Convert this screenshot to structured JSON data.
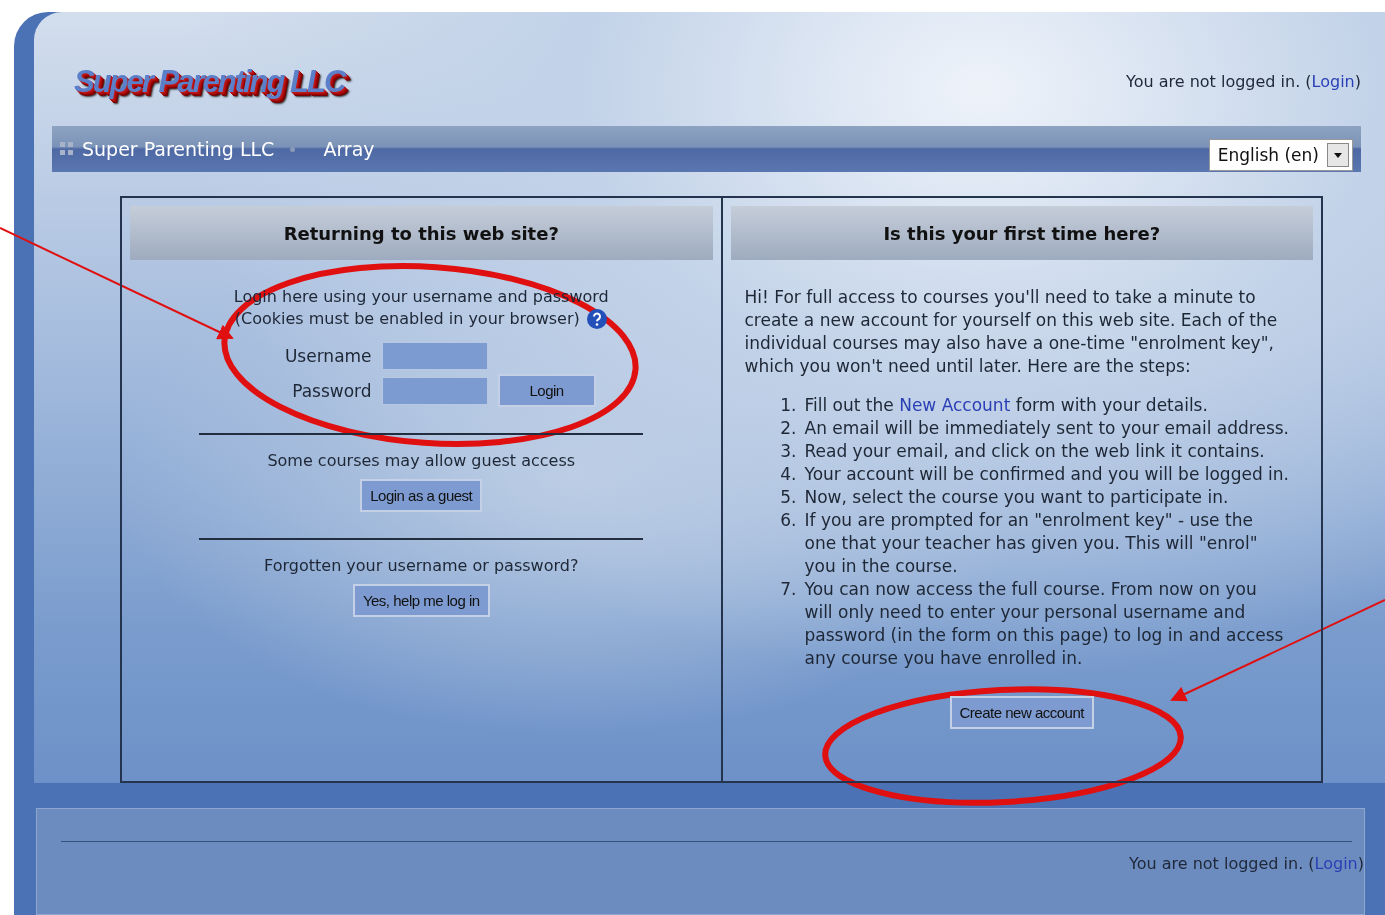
{
  "header": {
    "logo": "Super Parenting LLC",
    "login_info": {
      "prefix": "You are not logged in. (",
      "link": "Login",
      "suffix": ")"
    }
  },
  "navbar": {
    "breadcrumbs": [
      "Super Parenting LLC",
      "Array"
    ],
    "language": "English (en)"
  },
  "login_panel": {
    "heading": "Returning to this web site?",
    "intro": [
      "Login here using your username and password",
      "(Cookies must be enabled in your browser)"
    ],
    "username_label": "Username",
    "password_label": "Password",
    "login_button": "Login",
    "guest_text": "Some courses may allow guest access",
    "guest_button": "Login as a guest",
    "forgot_text": "Forgotten your username or password?",
    "forgot_button": "Yes, help me log in"
  },
  "signup_panel": {
    "heading": "Is this your first time here?",
    "intro": "Hi! For full access to courses you'll need to take a minute to create a new account for yourself on this web site. Each of the individual courses may also have a one-time \"enrolment key\", which you won't need until later. Here are the steps:",
    "steps": [
      {
        "kind": "link",
        "number": "1.",
        "prefix": "Fill out the ",
        "link": "New Account",
        "suffix": " form with your details."
      },
      {
        "kind": "text",
        "number": "2.",
        "text": "An email will be immediately sent to your email address."
      },
      {
        "kind": "text",
        "number": "3.",
        "text": "Read your email, and click on the web link it contains."
      },
      {
        "kind": "text",
        "number": "4.",
        "text": "Your account will be confirmed and you will be logged in."
      },
      {
        "kind": "text",
        "number": "5.",
        "text": "Now, select the course you want to participate in."
      },
      {
        "kind": "text",
        "number": "6.",
        "text": "If you are prompted for an \"enrolment key\" - use the one that your teacher has given you. This will \"enrol\" you in the course."
      },
      {
        "kind": "text",
        "number": "7.",
        "text": "You can now access the full course. From now on you will only need to enter your personal username and password (in the form on this page) to log in and access any course you have enrolled in."
      }
    ],
    "create_button": "Create new account"
  },
  "footer": {
    "login_info": {
      "prefix": "You are not logged in. (",
      "link": "Login",
      "suffix": ")"
    }
  }
}
